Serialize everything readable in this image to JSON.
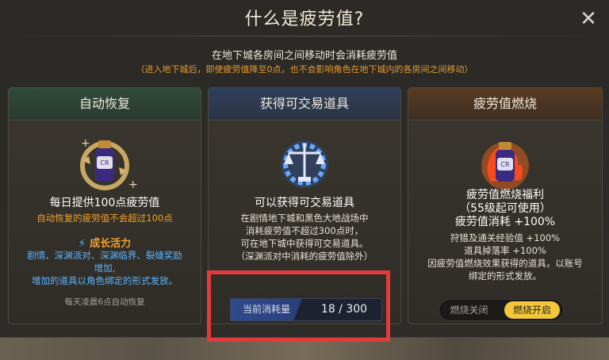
{
  "dialog": {
    "title": "什么是疲劳值?",
    "subtitle": "在地下城各房间之间移动时会消耗疲劳值",
    "note": "（进入地下城后，即使疲劳值降至0点，也不会影响角色在地下城内的各房间之间移动）"
  },
  "cards": [
    {
      "title": "自动恢复",
      "icon": "potion-recovery-icon",
      "main": "每日提供100点疲劳值",
      "sub": "自动恢复的疲劳值不会超过100点",
      "growth_title": "成长活力",
      "growth_desc_1": "剧情、深渊派对、深渊临界、裂缝奖励",
      "growth_desc_2": "增加,",
      "growth_desc_3": "增加的道具以角色绑定的形式发放。",
      "footer": "每天凌晨6点自动恢复"
    },
    {
      "title": "获得可交易道具",
      "icon": "scales-gear-icon",
      "main": "可以获得可交易道具",
      "desc_1": "在剧情地下城和黑色大地战场中",
      "desc_2": "消耗疲劳值不超过300点时，",
      "desc_3": "可在地下城中获得可交易道具。",
      "desc_4": "（深渊派对中消耗的疲劳值除外）",
      "meter_label": "当前消耗量",
      "meter_value": "18 / 300",
      "meter_progress": 0.06
    },
    {
      "title": "疲劳值燃烧",
      "icon": "potion-burning-icon",
      "main_1": "疲劳值燃烧福利",
      "main_2": "（55级起可使用）",
      "main_3": "疲劳值消耗 +100%",
      "desc_1": "狩猎及通关经验值 +100%",
      "desc_2": "道具掉落率 +100%",
      "desc_3": "因疲劳值燃烧效果获得的道具，以账号",
      "desc_4": "绑定的形式发放。",
      "toggle_off": "燃烧关闭",
      "toggle_on": "燃烧开启",
      "active": "燃烧开启"
    }
  ],
  "colors": {
    "accent_orange": "#f0a02e",
    "accent_blue": "#5db6ff",
    "toggle_on": "#f3c63b",
    "highlight_box": "#e33a3a"
  }
}
